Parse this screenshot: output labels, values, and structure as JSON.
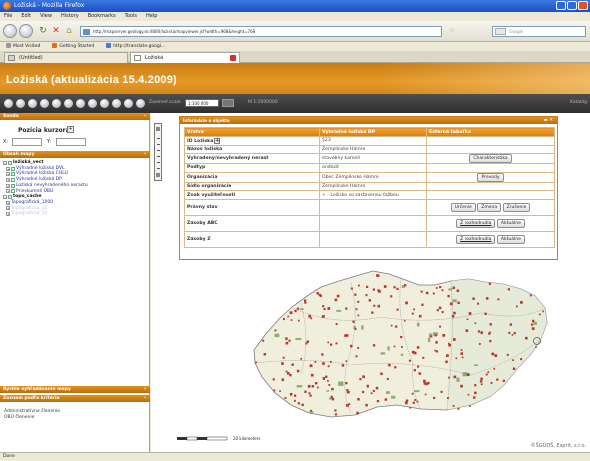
{
  "window": {
    "title": "Ložiská - Mozilla Firefox"
  },
  "menu": [
    "File",
    "Edit",
    "View",
    "History",
    "Bookmarks",
    "Tools",
    "Help"
  ],
  "navigation": {
    "url": "http://mapserver.geology.sk:8080/loziska/mapviewer.jsf?width=968&height=768",
    "search_placeholder": "Google"
  },
  "bookmarks": [
    "Most Visited",
    "Getting Started",
    "http://translate.googl..."
  ],
  "tabs": [
    {
      "label": "(Untitled)"
    },
    {
      "label": "Ložiská"
    }
  ],
  "app": {
    "title": "Ložiská (aktualizácia 15.4.2009)"
  },
  "toolbar": {
    "scale_label": "Zoomed scale",
    "scale_value": "1:100 000",
    "start_label": "M 1:2000000",
    "right_label": "Katalóg"
  },
  "left_panel": {
    "search_header": "Sonda",
    "position_title": "Pozícia kurzora",
    "position_button": "+",
    "x_label": "X:",
    "y_label": "Y:",
    "layers_header": "Obsah mapy",
    "layers": [
      {
        "label": "ložiská_vect",
        "level": 0,
        "style": "bold"
      },
      {
        "label": "Výhradné ložiská DVL",
        "level": 1,
        "style": "normal"
      },
      {
        "label": "Výhradné ložiská CHLÚ",
        "level": 1,
        "style": "normal"
      },
      {
        "label": "Výhradné ložiská DP",
        "level": 1,
        "style": "normal"
      },
      {
        "label": "Ložiská nevyhradeného nerastu",
        "level": 1,
        "style": "normal"
      },
      {
        "label": "Prieskumné ÚBÚ",
        "level": 1,
        "style": "normal"
      },
      {
        "label": "topo_cache",
        "level": 0,
        "style": "bold"
      },
      {
        "label": "Topografická_1000",
        "level": 1,
        "style": "normal"
      },
      {
        "label": "Topografická_50",
        "level": 1,
        "style": "dim"
      },
      {
        "label": "Topografická_10",
        "level": 1,
        "style": "dim"
      }
    ],
    "quick_header": "Rýchle vyhľadávanie mapy",
    "zoznam_header": "Zoznam podľa kritéria",
    "zoznam_items": [
      "Administratívne členenie",
      "OBÚ členenie"
    ]
  },
  "info_panel": {
    "header": "Informácie o objekte",
    "columns": [
      "Vrstva",
      "Výhradné ložiská DP",
      "Externá tabuľka"
    ],
    "rows": [
      {
        "key": "ID Ložiska",
        "value": "523",
        "buttons": []
      },
      {
        "key": "Názov ložiska",
        "value": "Zemplínske Hámre",
        "buttons": []
      },
      {
        "key": "Vyhradený/nevyhradený nerast",
        "value": "stavebný kameň",
        "buttons": [
          "Charakteristika"
        ]
      },
      {
        "key": "Podtyp",
        "value": "andezit",
        "buttons": []
      },
      {
        "key": "Organizácia",
        "value": "Obec Zemplínske Hámre",
        "buttons": [
          "Prevody"
        ]
      },
      {
        "key": "Sídlo organizácie",
        "value": "Zemplínske Hámre",
        "buttons": []
      },
      {
        "key": "Znak využiteľnosti",
        "value": "+ - Ložisko so zastavenou ťažbou",
        "buttons": []
      },
      {
        "key": "Právny stav",
        "value": "",
        "buttons": [
          "Určenie",
          "Zmena",
          "Zrušenie"
        ]
      },
      {
        "key": "Zásoby ABC",
        "value": "",
        "buttons": [
          "Z rozhodnutia",
          "Aktuálne"
        ]
      },
      {
        "key": "Zásoby Z",
        "value": "",
        "buttons": [
          "Z rozhodnutia",
          "Aktuálne"
        ]
      }
    ]
  },
  "map": {
    "scalebar_label": "20 kilometers",
    "copyright": "©ŠGÚDŠ, Esprit, s.r.o.",
    "colors": {
      "territory": "#f0eedd",
      "region_tint": "#e3ead8",
      "border": "#7c7c7c",
      "deposit": "#b63a2c",
      "forest": "#6f8e43"
    }
  },
  "status": {
    "text": "Done"
  }
}
